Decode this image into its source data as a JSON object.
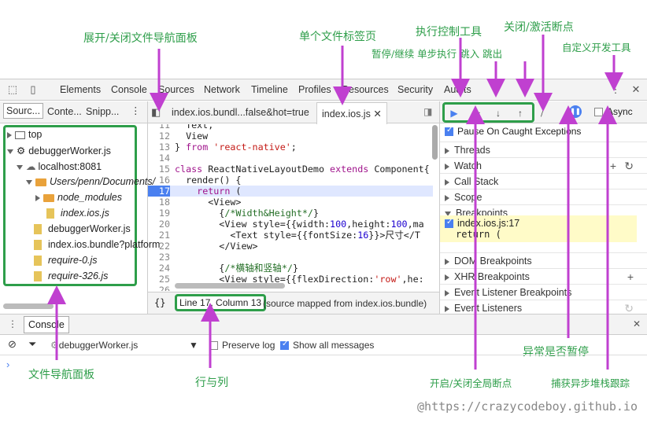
{
  "annotations": {
    "nav_toggle": "展开/关闭文件导航面板",
    "single_tab": "单个文件标签页",
    "exec_control": "执行控制工具",
    "deactivate": "关闭/激活断点",
    "step_desc": "暂停/继续 单步执行 跳入 跳出",
    "customize": "自定义开发工具",
    "file_nav": "文件导航面板",
    "line_col": "行与列",
    "global_bp": "开启/关闭全局断点",
    "pause_exc": "异常是否暂停",
    "async_trace": "捕获异步堆栈跟踪",
    "watermark": "@https://crazycodeboy.github.io"
  },
  "toolbar": {
    "tabs": [
      "Elements",
      "Console",
      "Sources",
      "Network",
      "Timeline",
      "Profiles",
      "Resources",
      "Security",
      "Audits"
    ]
  },
  "navigator": {
    "tabs": [
      "Sourc...",
      "Conte...",
      "Snipp..."
    ],
    "tree": {
      "top": "top",
      "worker": "debuggerWorker.js",
      "host": "localhost:8081",
      "folder": "Users/penn/Documents/",
      "modules": "node_modules",
      "index": "index.ios.js",
      "f1": "debuggerWorker.js",
      "f2": "index.ios.bundle?platform",
      "f3": "require-0.js",
      "f4": "require-326.js"
    }
  },
  "editor": {
    "tab1": "index.ios.bundl...false&hot=true",
    "tab2": "index.ios.js",
    "position": "Line 17, Column 13",
    "mapped": "(source mapped from index.ios.bundle)",
    "curly": "{}"
  },
  "debugger": {
    "async": "Async",
    "pause_caught": "Pause On Caught Exceptions",
    "sections": {
      "threads": "Threads",
      "watch": "Watch",
      "callstack": "Call Stack",
      "scope": "Scope",
      "breakpoints": "Breakpoints",
      "dom": "DOM Breakpoints",
      "xhr": "XHR Breakpoints",
      "listener_bp": "Event Listener Breakpoints",
      "listeners": "Event Listeners"
    },
    "bp_file": "index.ios.js:17",
    "bp_code": "return ("
  },
  "console": {
    "tab": "Console",
    "context": "debuggerWorker.js",
    "preserve": "Preserve log",
    "show_all": "Show all messages",
    "prompt": "›"
  }
}
